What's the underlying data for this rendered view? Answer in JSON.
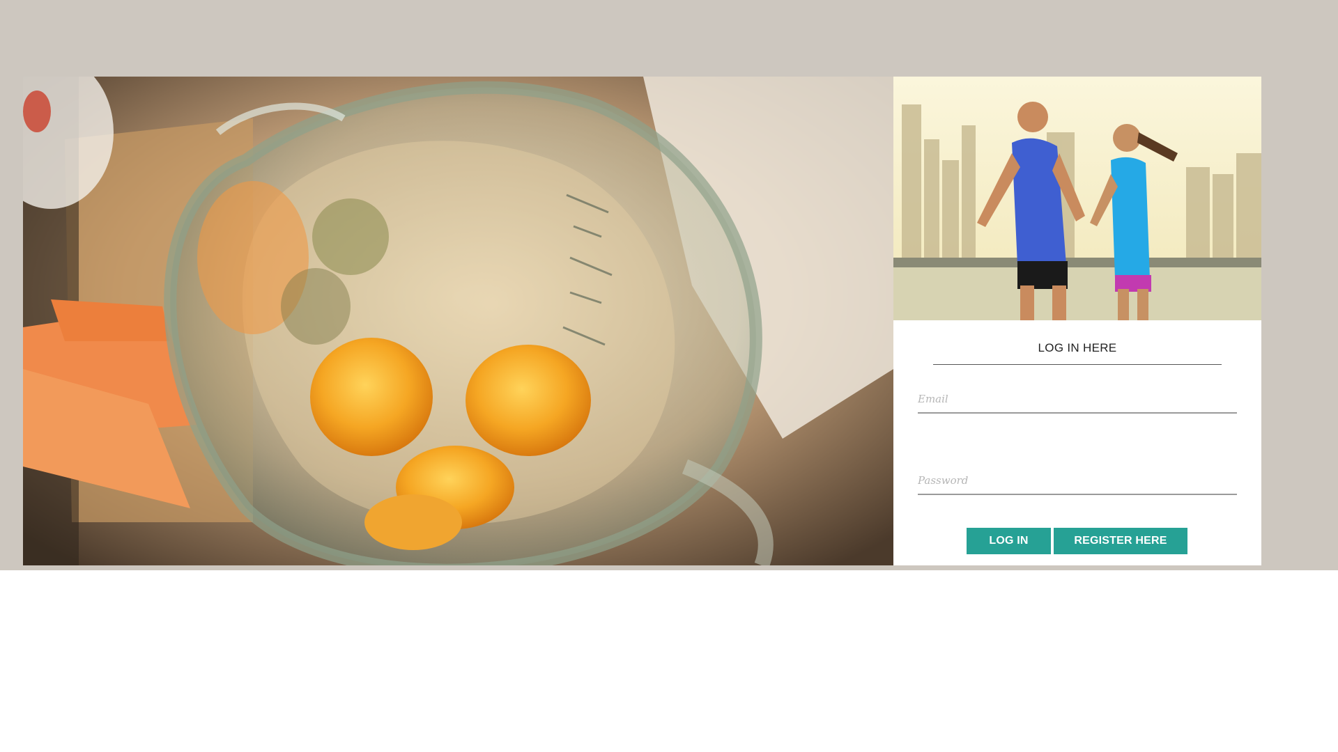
{
  "login": {
    "title": "LOG IN HERE",
    "email_placeholder": "Email",
    "password_placeholder": "Password",
    "login_button": "LOG IN",
    "register_button": "REGISTER HERE"
  },
  "images": {
    "hero": "blender-with-oranges-photo",
    "card": "couple-running-by-city-waterfront-photo"
  },
  "colors": {
    "page_background": "#cdc7bf",
    "button": "#26a195",
    "button_text": "#ffffff"
  }
}
